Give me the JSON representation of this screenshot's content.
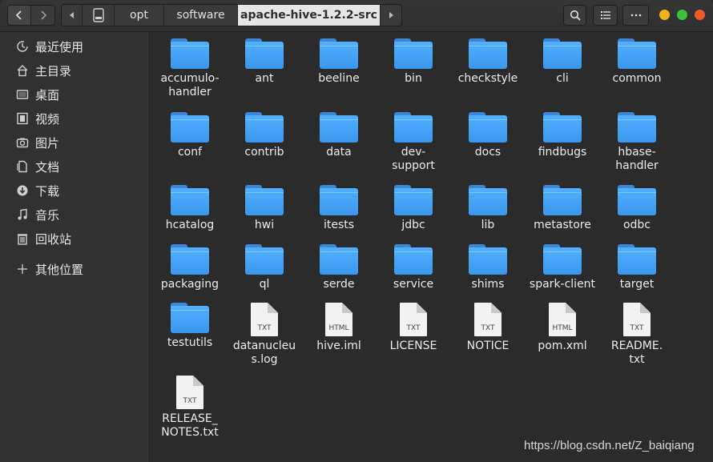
{
  "header": {
    "breadcrumbs": [
      "opt",
      "software",
      "apache-hive-1.2.2-src"
    ]
  },
  "sidebar": {
    "items": [
      {
        "label": "最近使用",
        "icon": "recent-icon"
      },
      {
        "label": "主目录",
        "icon": "home-icon"
      },
      {
        "label": "桌面",
        "icon": "desktop-icon"
      },
      {
        "label": "视频",
        "icon": "video-icon"
      },
      {
        "label": "图片",
        "icon": "pictures-icon"
      },
      {
        "label": "文档",
        "icon": "documents-icon"
      },
      {
        "label": "下载",
        "icon": "downloads-icon"
      },
      {
        "label": "音乐",
        "icon": "music-icon"
      },
      {
        "label": "回收站",
        "icon": "trash-icon"
      }
    ],
    "other_locations": "其他位置"
  },
  "files": [
    {
      "name": "accumulo-\nhandler",
      "kind": "folder"
    },
    {
      "name": "ant",
      "kind": "folder"
    },
    {
      "name": "beeline",
      "kind": "folder"
    },
    {
      "name": "bin",
      "kind": "folder"
    },
    {
      "name": "checkstyle",
      "kind": "folder"
    },
    {
      "name": "cli",
      "kind": "folder"
    },
    {
      "name": "common",
      "kind": "folder"
    },
    {
      "name": "conf",
      "kind": "folder"
    },
    {
      "name": "contrib",
      "kind": "folder"
    },
    {
      "name": "data",
      "kind": "folder"
    },
    {
      "name": "dev-\nsupport",
      "kind": "folder"
    },
    {
      "name": "docs",
      "kind": "folder"
    },
    {
      "name": "findbugs",
      "kind": "folder"
    },
    {
      "name": "hbase-\nhandler",
      "kind": "folder"
    },
    {
      "name": "hcatalog",
      "kind": "folder"
    },
    {
      "name": "hwi",
      "kind": "folder"
    },
    {
      "name": "itests",
      "kind": "folder"
    },
    {
      "name": "jdbc",
      "kind": "folder"
    },
    {
      "name": "lib",
      "kind": "folder"
    },
    {
      "name": "metastore",
      "kind": "folder"
    },
    {
      "name": "odbc",
      "kind": "folder"
    },
    {
      "name": "packaging",
      "kind": "folder"
    },
    {
      "name": "ql",
      "kind": "folder"
    },
    {
      "name": "serde",
      "kind": "folder"
    },
    {
      "name": "service",
      "kind": "folder"
    },
    {
      "name": "shims",
      "kind": "folder"
    },
    {
      "name": "spark-client",
      "kind": "folder"
    },
    {
      "name": "target",
      "kind": "folder"
    },
    {
      "name": "testutils",
      "kind": "folder"
    },
    {
      "name": "datanucleu\ns.log",
      "kind": "file",
      "type": "TXT"
    },
    {
      "name": "hive.iml",
      "kind": "file",
      "type": "HTML"
    },
    {
      "name": "LICENSE",
      "kind": "file",
      "type": "TXT"
    },
    {
      "name": "NOTICE",
      "kind": "file",
      "type": "TXT"
    },
    {
      "name": "pom.xml",
      "kind": "file",
      "type": "HTML"
    },
    {
      "name": "README.\ntxt",
      "kind": "file",
      "type": "TXT"
    },
    {
      "name": "RELEASE_\nNOTES.txt",
      "kind": "file",
      "type": "TXT"
    }
  ],
  "watermark": "https://blog.csdn.net/Z_baiqiang",
  "colors": {
    "folder": "#42a1f5",
    "selected_crumb": "#e6e6e6",
    "close": "#ee5a2a",
    "minimize": "#f5b11b",
    "maximize": "#3cc13c"
  }
}
